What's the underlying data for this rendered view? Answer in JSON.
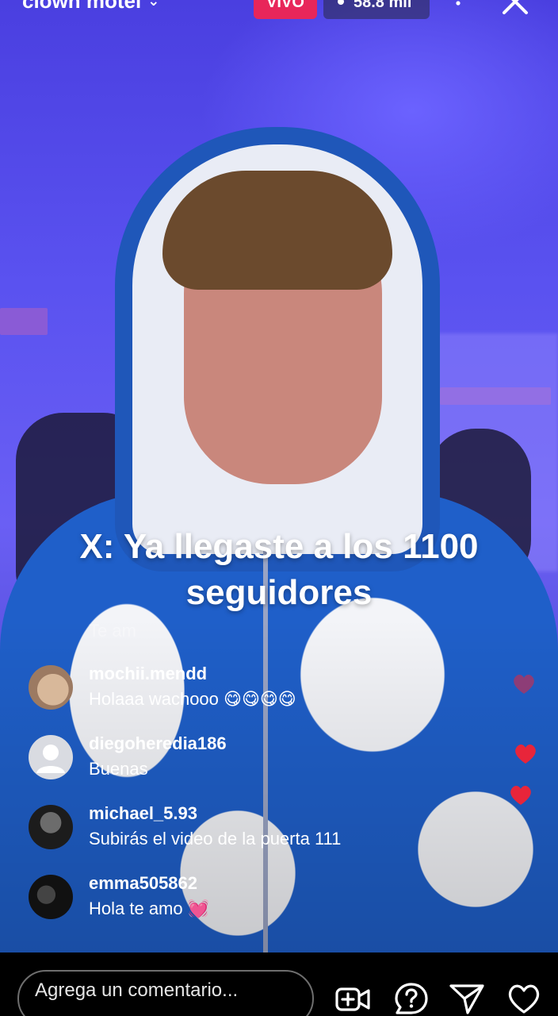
{
  "header": {
    "username": "clown motel",
    "live_label": "VIVO",
    "viewers": "58.8 mil"
  },
  "overlay": {
    "question": "X: Ya llegaste a los 1100 seguidores"
  },
  "comments": {
    "faded_text": "Te am",
    "items": [
      {
        "username": "mochii.mendd",
        "text": "Holaaa wachooo 😋😋😋😋"
      },
      {
        "username": "diegoheredia186",
        "text": "Buenas"
      },
      {
        "username": "michael_5.93",
        "text": "Subirás el video de la puerta 111"
      },
      {
        "username": "emma505862",
        "text": "Hola te amo 💓"
      }
    ]
  },
  "composer": {
    "placeholder": "Agrega un comentario..."
  },
  "icons": {
    "header": [
      "chevron-down-icon",
      "more-icon",
      "close-icon"
    ],
    "bottom": [
      "add-video-icon",
      "question-icon",
      "send-icon",
      "heart-icon"
    ],
    "floating": "heart-icon"
  },
  "colors": {
    "live_badge": "#e8265a",
    "heart": "#e8253a"
  }
}
